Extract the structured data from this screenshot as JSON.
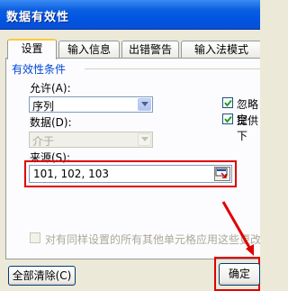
{
  "window": {
    "title": "数据有效性"
  },
  "tabs": [
    {
      "label": "设置"
    },
    {
      "label": "输入信息"
    },
    {
      "label": "出错警告"
    },
    {
      "label": "输入法模式"
    }
  ],
  "settings": {
    "group_title": "有效性条件",
    "allow_label": "允许(A):",
    "allow_value": "序列",
    "data_label": "数据(D):",
    "data_value": "介于",
    "source_label": "来源(S):",
    "source_value": "101, 102, 103",
    "ignore_blank_label": "忽略空",
    "ignore_blank_checked": true,
    "dropdown_label": "提供下",
    "dropdown_checked": true,
    "apply_all_label": "对有同样设置的所有其他单元格应用这些更改",
    "apply_all_checked": false
  },
  "buttons": {
    "clear_all_label": "全部清除(C)",
    "ok_label": "确定"
  },
  "colors": {
    "title_bar": "#0054e3",
    "annotation": "#e00000",
    "group_title": "#0046d5"
  },
  "icons": [
    "dropdown-arrow-icon",
    "check-icon",
    "range-select-icon",
    "annotation-arrow-icon"
  ]
}
